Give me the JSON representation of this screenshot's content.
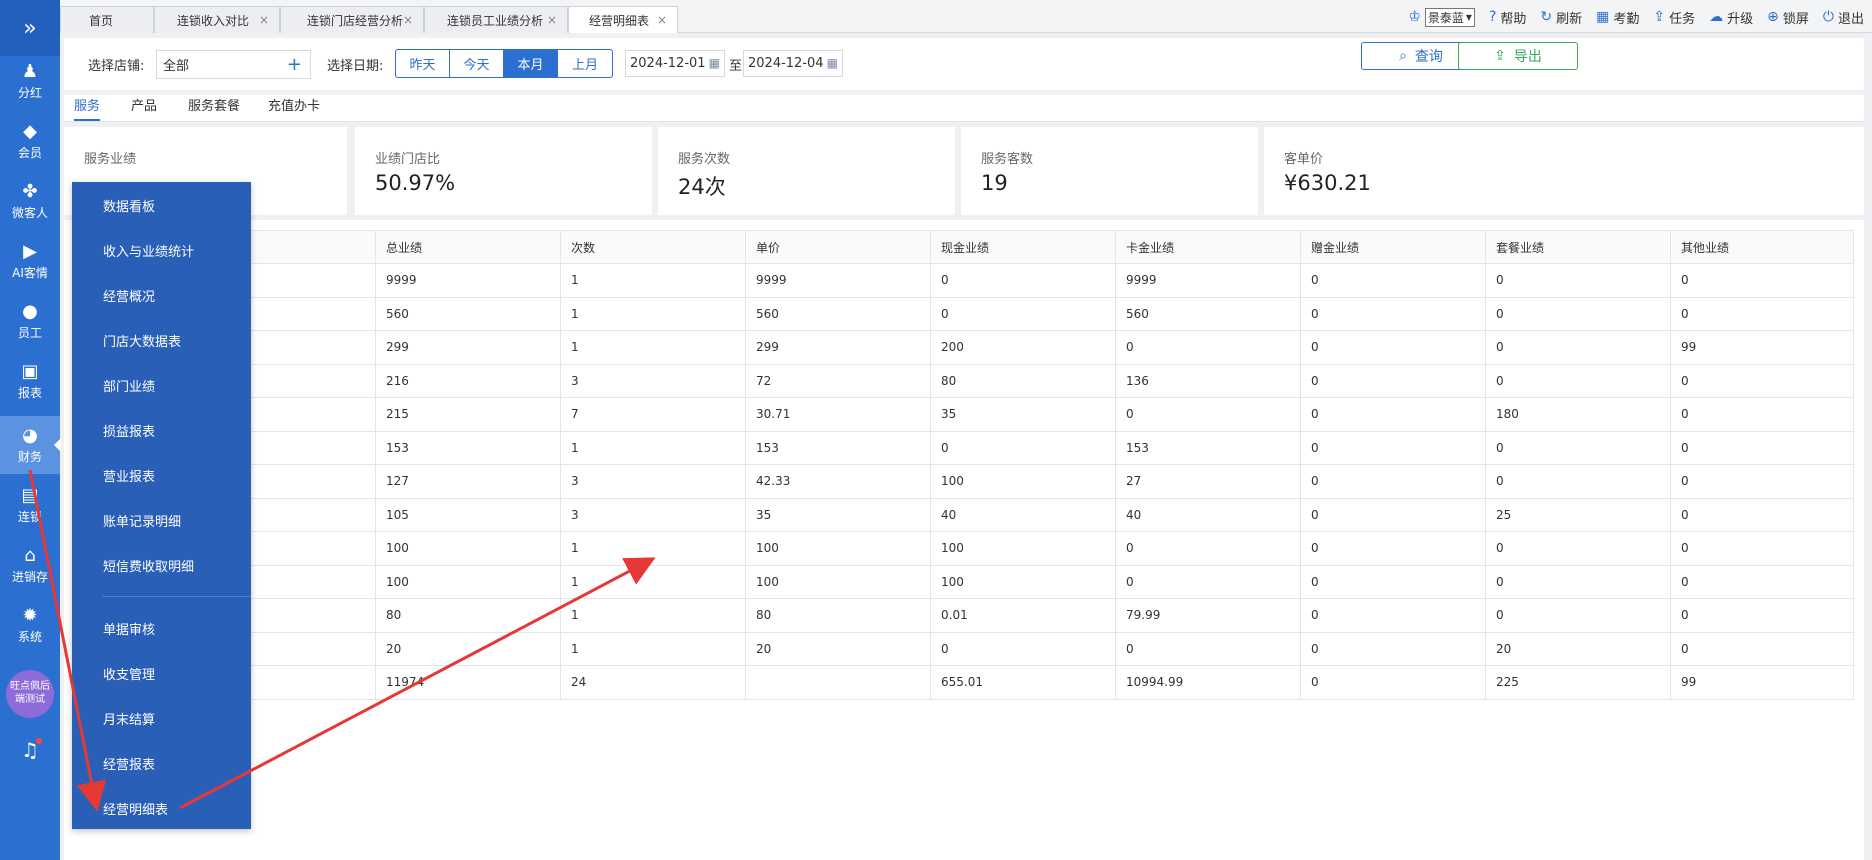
{
  "nav": {
    "expand_icon": "double-chevron-right",
    "items": [
      {
        "label": "分红",
        "icon": "user-coin-icon"
      },
      {
        "label": "会员",
        "icon": "diamond-icon"
      },
      {
        "label": "微客人",
        "icon": "grid-icon"
      },
      {
        "label": "AI客情",
        "icon": "play-circle-icon"
      },
      {
        "label": "员工",
        "icon": "person-icon"
      },
      {
        "label": "报表",
        "icon": "monitor-icon"
      },
      {
        "label": "财务",
        "icon": "pie-chart-icon"
      },
      {
        "label": "连锁",
        "icon": "store-icon"
      },
      {
        "label": "进销存",
        "icon": "home-icon"
      },
      {
        "label": "系统",
        "icon": "gear-icon"
      }
    ],
    "active": "财务",
    "promo": "旺点佩后\n端测试"
  },
  "tabs": [
    {
      "label": "首页"
    },
    {
      "label": "连锁收入对比"
    },
    {
      "label": "连锁门店经营分析"
    },
    {
      "label": "连锁员工业绩分析"
    },
    {
      "label": "经营明细表"
    }
  ],
  "toolbar": {
    "skin": "景泰蓝",
    "help": "帮助",
    "refresh": "刷新",
    "attendance": "考勤",
    "task": "任务",
    "upgrade": "升级",
    "lock": "锁屏",
    "logout": "退出"
  },
  "filter": {
    "store_label": "选择店铺:",
    "store_value": "全部",
    "date_label": "选择日期:",
    "date_buttons": [
      "昨天",
      "今天",
      "本月",
      "上月"
    ],
    "date_active": "本月",
    "start_date": "2024-12-01",
    "to": "至",
    "end_date": "2024-12-04",
    "query": "查询",
    "export": "导出"
  },
  "subtabs": [
    "服务",
    "产品",
    "服务套餐",
    "充值办卡"
  ],
  "subtab_active": "服务",
  "cards": [
    {
      "title": "服务业绩",
      "value": ""
    },
    {
      "title": "业绩门店比",
      "value": "50.97%"
    },
    {
      "title": "服务次数",
      "value": "24次"
    },
    {
      "title": "服务客数",
      "value": "19"
    },
    {
      "title": "客单价",
      "value": "¥630.21"
    }
  ],
  "table": {
    "headers": [
      "",
      "总业绩",
      "次数",
      "单价",
      "现金业绩",
      "卡金业绩",
      "赠金业绩",
      "套餐业绩",
      "其他业绩"
    ],
    "rows": [
      [
        "",
        "9999",
        "1",
        "9999",
        "0",
        "9999",
        "0",
        "0",
        "0"
      ],
      [
        "",
        "560",
        "1",
        "560",
        "0",
        "560",
        "0",
        "0",
        "0"
      ],
      [
        "",
        "299",
        "1",
        "299",
        "200",
        "0",
        "0",
        "0",
        "99"
      ],
      [
        "",
        "216",
        "3",
        "72",
        "80",
        "136",
        "0",
        "0",
        "0"
      ],
      [
        "",
        "215",
        "7",
        "30.71",
        "35",
        "0",
        "0",
        "180",
        "0"
      ],
      [
        "",
        "153",
        "1",
        "153",
        "0",
        "153",
        "0",
        "0",
        "0"
      ],
      [
        "",
        "127",
        "3",
        "42.33",
        "100",
        "27",
        "0",
        "0",
        "0"
      ],
      [
        "",
        "105",
        "3",
        "35",
        "40",
        "40",
        "0",
        "25",
        "0"
      ],
      [
        "",
        "100",
        "1",
        "100",
        "100",
        "0",
        "0",
        "0",
        "0"
      ],
      [
        "",
        "100",
        "1",
        "100",
        "100",
        "0",
        "0",
        "0",
        "0"
      ],
      [
        "",
        "80",
        "1",
        "80",
        "0.01",
        "79.99",
        "0",
        "0",
        "0"
      ],
      [
        "",
        "20",
        "1",
        "20",
        "0",
        "0",
        "0",
        "20",
        "0"
      ],
      [
        "",
        "11974",
        "24",
        "",
        "655.01",
        "10994.99",
        "0",
        "225",
        "99"
      ]
    ]
  },
  "menu": {
    "items": [
      "数据看板",
      "收入与业绩统计",
      "经营概况",
      "门店大数据表",
      "部门业绩",
      "损益报表",
      "营业报表",
      "账单记录明细",
      "短信费收取明细",
      "单据审核",
      "收支管理",
      "月末结算",
      "经营报表",
      "经营明细表"
    ]
  },
  "annotation": {
    "color": "#e53935"
  }
}
